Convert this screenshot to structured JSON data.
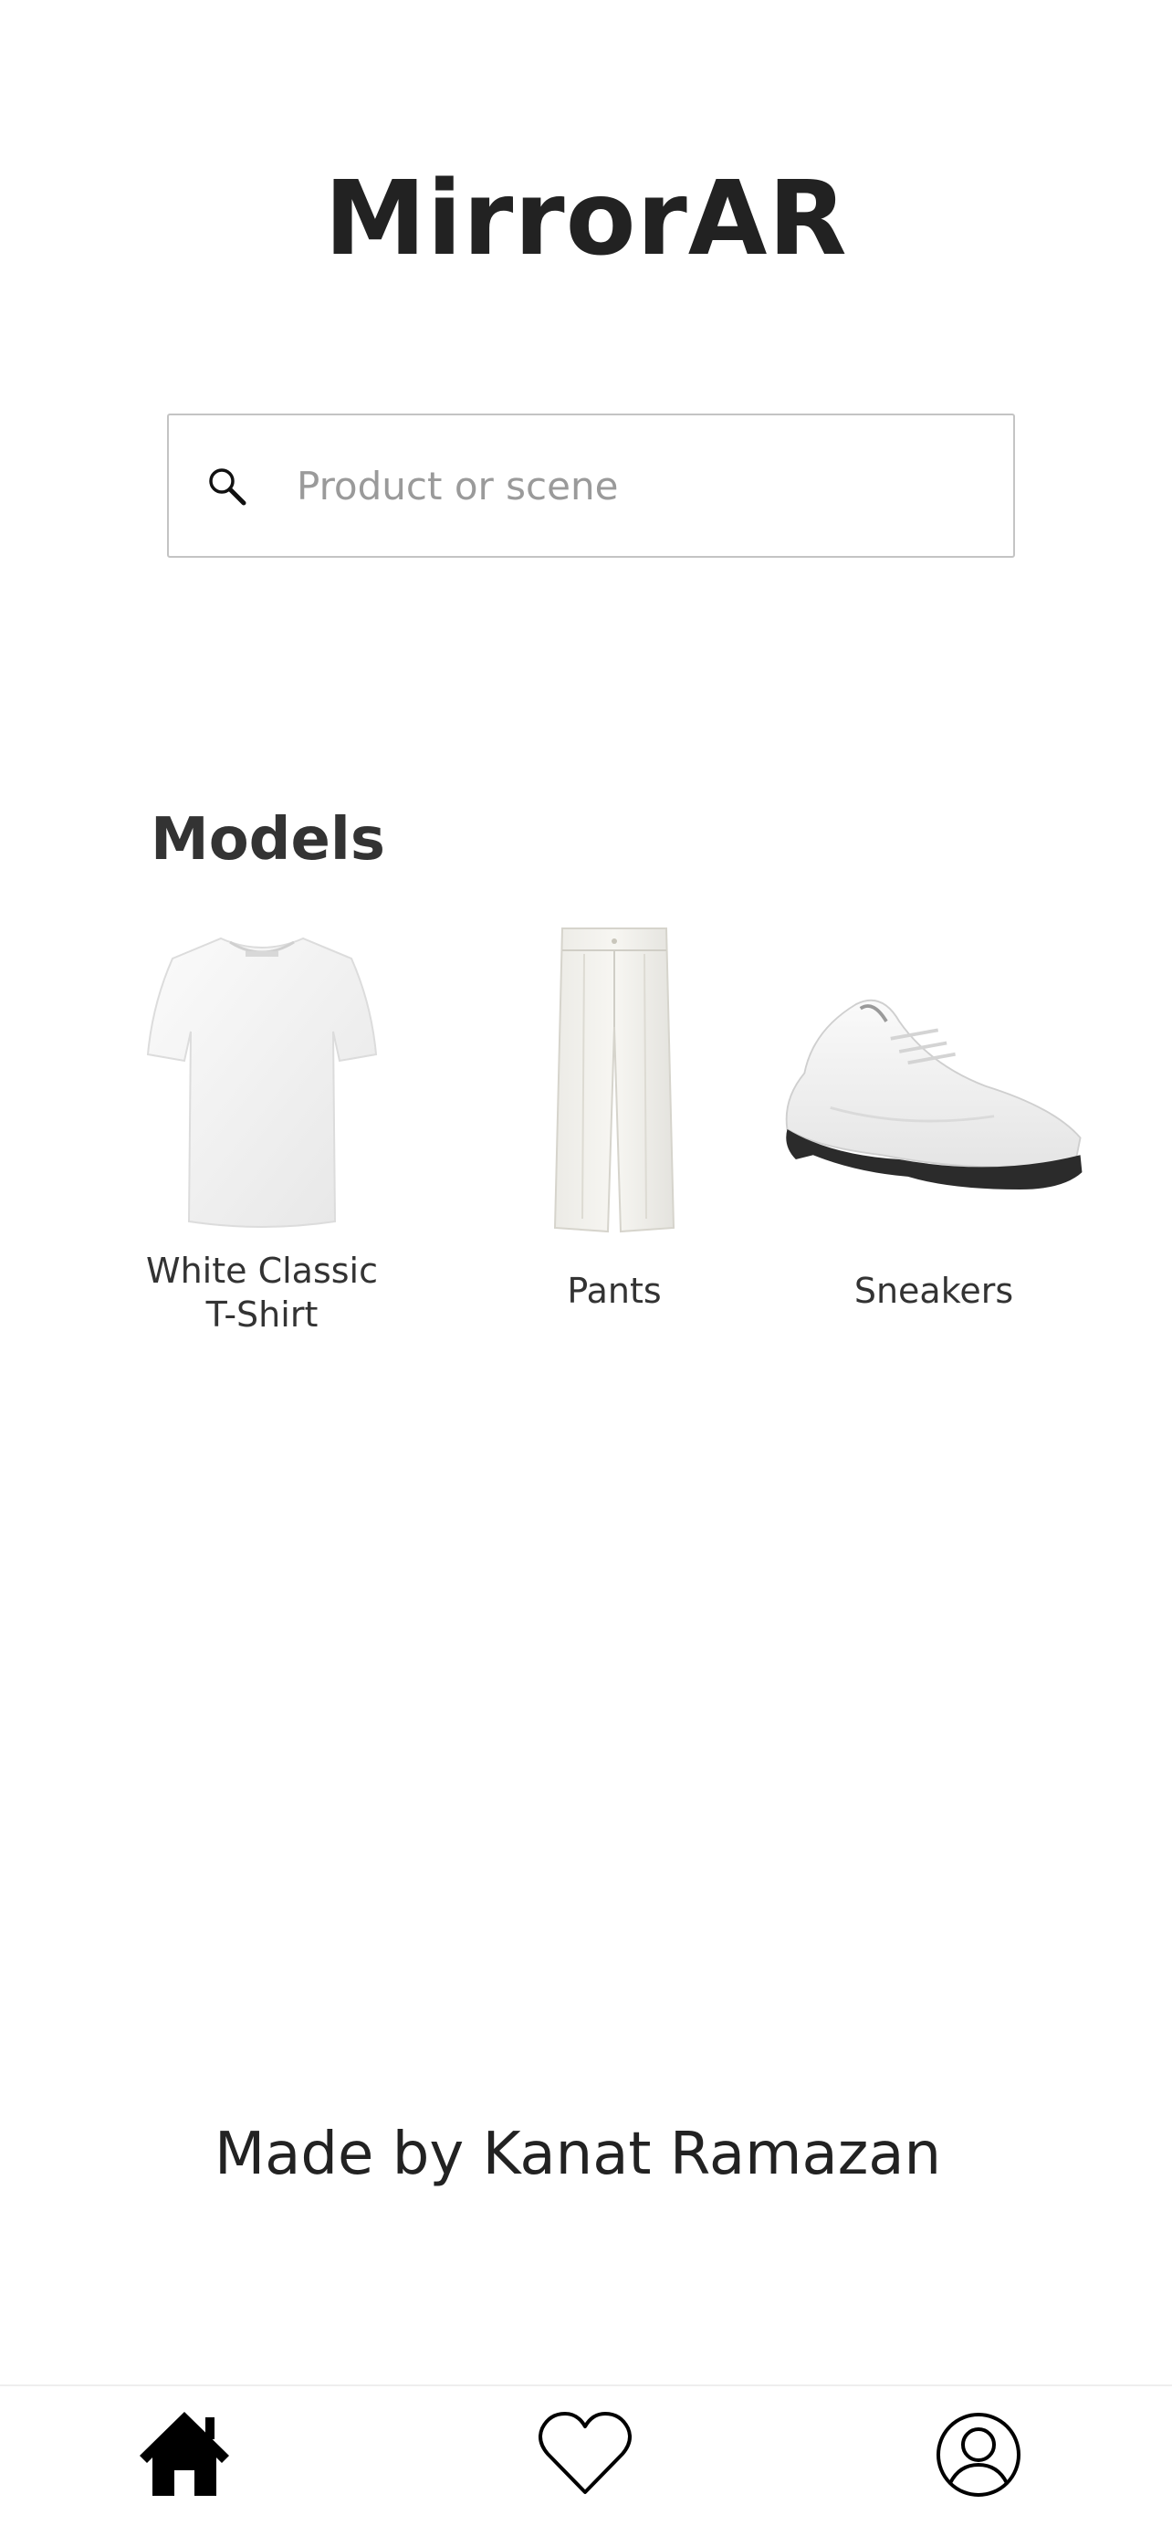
{
  "app": {
    "title": "MirrorAR"
  },
  "search": {
    "placeholder": "Product or scene",
    "value": "",
    "icon": "search-icon"
  },
  "models": {
    "heading": "Models",
    "items": [
      {
        "label": "White Classic\nT-Shirt",
        "icon": "tshirt-image"
      },
      {
        "label": "Pants",
        "icon": "pants-image"
      },
      {
        "label": "Sneakers",
        "icon": "sneakers-image"
      }
    ]
  },
  "footer": {
    "credit": "Made by Kanat Ramazan"
  },
  "tab_bar": {
    "items": [
      {
        "name": "home",
        "icon": "home-icon",
        "active": true
      },
      {
        "name": "favorites",
        "icon": "heart-icon",
        "active": false
      },
      {
        "name": "profile",
        "icon": "user-icon",
        "active": false
      }
    ]
  },
  "colors": {
    "text": "#222222",
    "placeholder": "#9a9a9a",
    "border": "#c4c4c4",
    "background": "#ffffff"
  }
}
